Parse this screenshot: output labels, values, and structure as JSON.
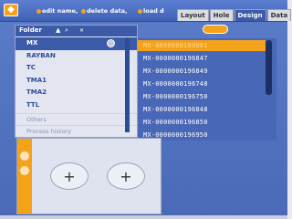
{
  "toolbar": {
    "hint_1": "edit name,",
    "hint_2": "delete data,",
    "hint_3": "load d",
    "tabs": [
      "Layout",
      "Hole",
      "Design",
      "Data"
    ],
    "active_tab": "Design"
  },
  "folder": {
    "title": "Folder",
    "items": [
      "MX",
      "RAYBAN",
      "TC",
      "TMA1",
      "TMA2",
      "TTL"
    ],
    "selected": "MX",
    "footer": [
      "Others",
      "Process history"
    ]
  },
  "data_list": {
    "items": [
      "MX-0000000100081",
      "MX-0000000196847",
      "MX-0000000196849",
      "MX-0000000196748",
      "MX-0000000196750",
      "MX-0000000196848",
      "MX-0000000196850",
      "MX-0000000196950"
    ],
    "selected_index": 0
  },
  "preview": {
    "lens_symbols": [
      "+",
      "+"
    ]
  },
  "colors": {
    "accent": "#f4a21a",
    "panel_blue": "#3b5aa8"
  }
}
